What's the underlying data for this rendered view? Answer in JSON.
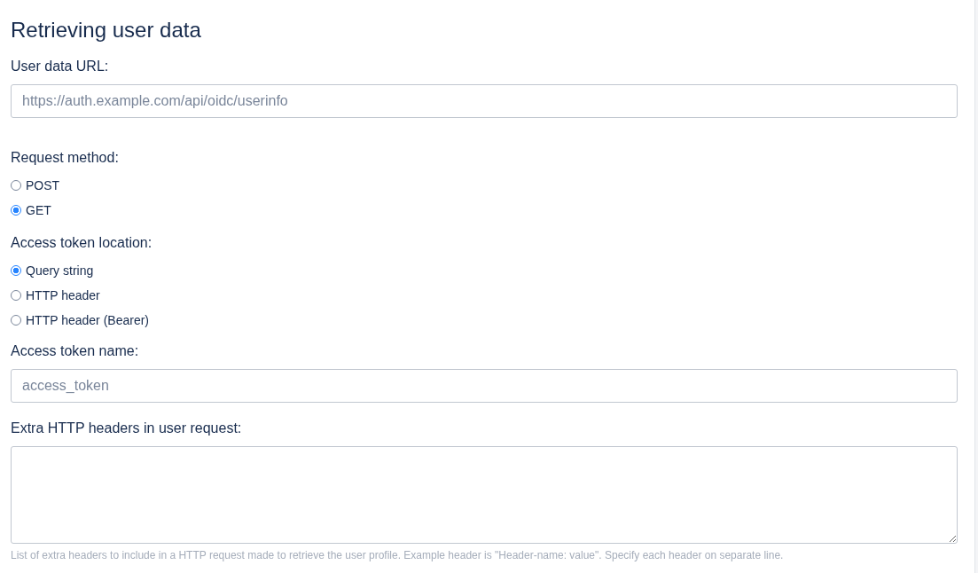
{
  "title": "Retrieving user data",
  "user_data_url": {
    "label": "User data URL:",
    "placeholder": "https://auth.example.com/api/oidc/userinfo"
  },
  "request_method": {
    "label": "Request method:",
    "options": [
      {
        "label": "POST",
        "selected": false
      },
      {
        "label": "GET",
        "selected": true
      }
    ]
  },
  "access_token_location": {
    "label": "Access token location:",
    "options": [
      {
        "label": "Query string",
        "selected": true
      },
      {
        "label": "HTTP header",
        "selected": false
      },
      {
        "label": "HTTP header (Bearer)",
        "selected": false
      }
    ]
  },
  "access_token_name": {
    "label": "Access token name:",
    "placeholder": "access_token"
  },
  "extra_headers": {
    "label": "Extra HTTP headers in user request:",
    "help": "List of extra headers to include in a HTTP request made to retrieve the user profile. Example header is \"Header-name: value\". Specify each header on separate line."
  }
}
